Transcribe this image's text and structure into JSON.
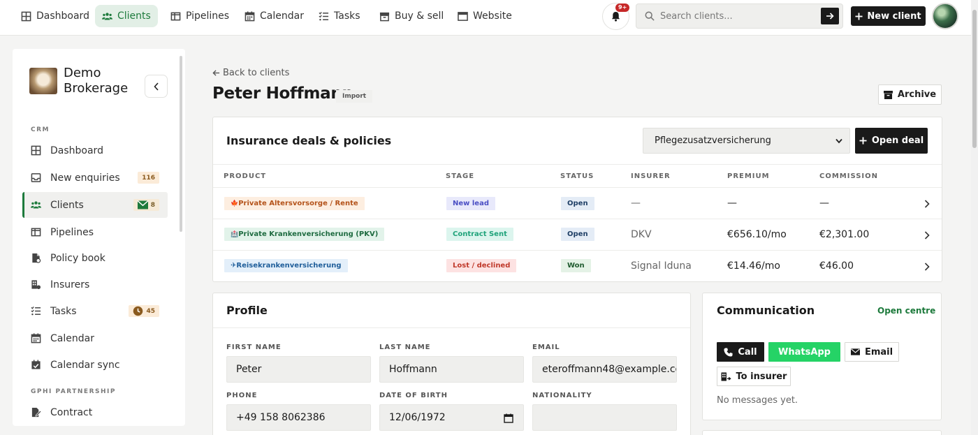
{
  "nav": {
    "tabs": [
      {
        "label": "Dashboard",
        "icon": "grid-icon"
      },
      {
        "label": "Clients",
        "icon": "users-icon",
        "active": true
      },
      {
        "label": "Pipelines",
        "icon": "columns-icon"
      },
      {
        "label": "Calendar",
        "icon": "calendar-icon"
      },
      {
        "label": "Tasks",
        "icon": "checklist-icon"
      },
      {
        "label": "Buy & sell",
        "icon": "box-icon"
      },
      {
        "label": "Website",
        "icon": "window-icon"
      }
    ],
    "notifications_badge": "9+",
    "search_placeholder": "Search clients...",
    "new_client_label": "New client"
  },
  "sidebar": {
    "brand": "Demo Brokerage",
    "sections": [
      {
        "label": "CRM"
      },
      {
        "label": "GPHI PARTNERSHIP"
      }
    ],
    "items": [
      {
        "label": "Dashboard",
        "icon": "grid-icon"
      },
      {
        "label": "New enquiries",
        "icon": "inbox-icon",
        "count": "116"
      },
      {
        "label": "Clients",
        "icon": "users-icon",
        "count": "8",
        "active": true
      },
      {
        "label": "Pipelines",
        "icon": "columns-icon"
      },
      {
        "label": "Policy book",
        "icon": "file-icon"
      },
      {
        "label": "Insurers",
        "icon": "building-icon"
      },
      {
        "label": "Tasks",
        "icon": "checklist-icon",
        "count": "45"
      },
      {
        "label": "Calendar",
        "icon": "calendar-icon"
      },
      {
        "label": "Calendar sync",
        "icon": "calendar-check-icon"
      },
      {
        "label": "Contract",
        "icon": "contract-icon"
      }
    ]
  },
  "client": {
    "back_label": "Back to clients",
    "name": "Peter Hoffmann",
    "tag": "Import",
    "archive_label": "Archive"
  },
  "deals": {
    "title": "Insurance deals & policies",
    "selected_product": "Pflegezusatzversicherung",
    "open_deal_label": "Open deal",
    "columns": [
      "PRODUCT",
      "STAGE",
      "STATUS",
      "INSURER",
      "PREMIUM",
      "COMMISSION"
    ],
    "rows": [
      {
        "product": "Private Altersvorsorge / Rente",
        "product_icon": "🍁",
        "stage": "New lead",
        "status": "Open",
        "insurer": "—",
        "premium": "—",
        "commission": "—"
      },
      {
        "product": "Private Krankenversicherung (PKV)",
        "product_icon": "🏥",
        "stage": "Contract Sent",
        "status": "Open",
        "insurer": "DKV",
        "premium": "€656.10/mo",
        "commission": "€2,301.00"
      },
      {
        "product": "Reisekrankenversicherung",
        "product_icon": "✈",
        "stage": "Lost / declined",
        "status": "Won",
        "insurer": "Signal Iduna",
        "premium": "€14.46/mo",
        "commission": "€46.00"
      }
    ],
    "colors": {
      "product_1_bg": "#fdeee0",
      "product_1_fg": "#b4531a",
      "product_2_bg": "#e2f3ea",
      "product_2_fg": "#1e6b40",
      "product_3_bg": "#e3effa",
      "product_3_fg": "#1f5e9a",
      "stage_1_bg": "#e8e9fb",
      "stage_1_fg": "#4b4fc4",
      "stage_2_bg": "#dcf5ee",
      "stage_2_fg": "#1fa37a",
      "stage_3_bg": "#fde2e2",
      "stage_3_fg": "#c0392b",
      "status_open_bg": "#e4ecf6",
      "status_open_fg": "#1f3f66",
      "status_won_bg": "#e4f2e6",
      "status_won_fg": "#1e5a2e"
    }
  },
  "profile": {
    "title": "Profile",
    "fields": {
      "first_name": {
        "label": "FIRST NAME",
        "value": "Peter"
      },
      "last_name": {
        "label": "LAST NAME",
        "value": "Hoffmann"
      },
      "email": {
        "label": "EMAIL",
        "value": "eteroffmann48@example.co"
      },
      "phone": {
        "label": "PHONE",
        "value": "+49 158 8062386"
      },
      "dob": {
        "label": "DATE OF BIRTH",
        "value": "12/06/1972"
      },
      "nationality": {
        "label": "NATIONALITY",
        "value": ""
      }
    }
  },
  "communication": {
    "title": "Communication",
    "open_centre_label": "Open centre",
    "call_label": "Call",
    "whatsapp_label": "WhatsApp",
    "email_label": "Email",
    "insurer_label": "To insurer",
    "empty_text": "No messages yet.",
    "whatsapp_color": "#25d366",
    "accent_color": "#1d7a3c"
  }
}
